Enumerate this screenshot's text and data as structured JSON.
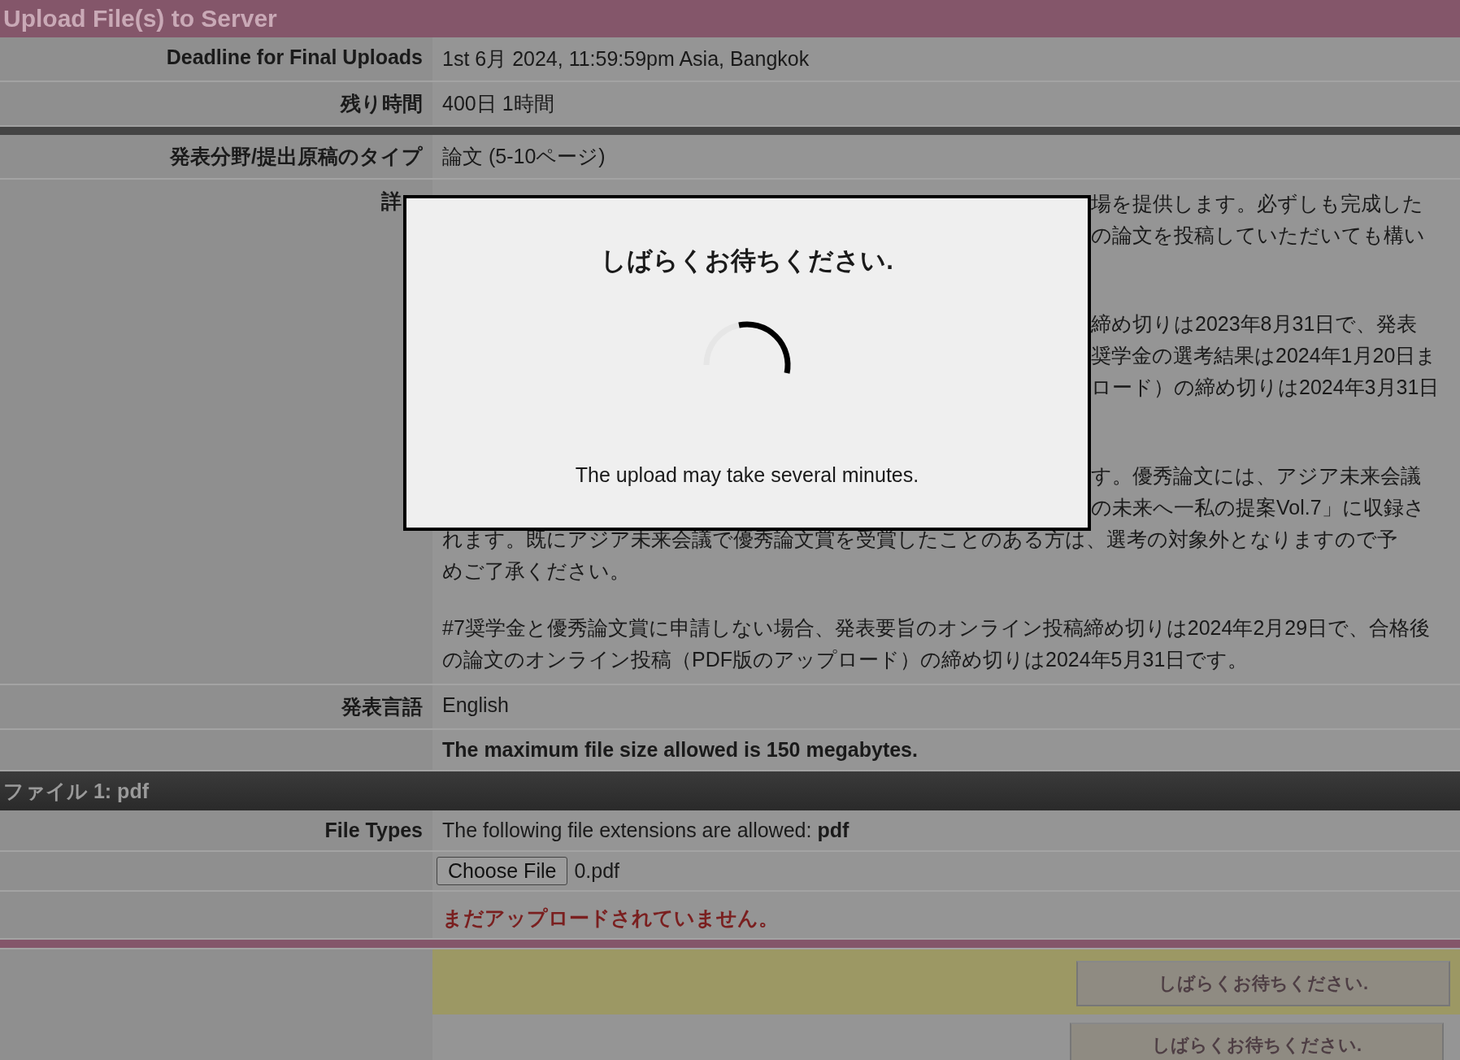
{
  "title": "Upload File(s) to Server",
  "rows": [
    {
      "kind": "text",
      "label": "Deadline for Final Uploads",
      "value": "1st 6月 2024, 11:59:59pm Asia, Bangkok"
    },
    {
      "kind": "text",
      "label": "残り時間",
      "value": "400日 1時間"
    },
    {
      "kind": "divider"
    },
    {
      "kind": "text",
      "label": "発表分野/提出原稿のタイプ",
      "value": "論文 (5-10ページ)"
    },
    {
      "kind": "details",
      "label": "詳",
      "label_covered": true,
      "paragraphs": [
        {
          "trailing_covered": true,
          "lines": [
            {
              "text": "場を提供します。必ずしも完成した",
              "covered": true
            },
            {
              "text": "の論文を投稿していただいても構い",
              "covered": true
            }
          ]
        },
        {
          "trailing_covered": true,
          "lines": [
            {
              "text": "締め切りは2023年8月31日で、発表",
              "covered": true
            },
            {
              "text": "奨学金の選考結果は2024年1月20日ま",
              "covered": true
            },
            {
              "text": "ロード）の締め切りは2024年3月31日",
              "covered": true
            }
          ]
        },
        {
          "trailing_covered": false,
          "lines": [
            {
              "text": "す。優秀論文には、アジア未来会議",
              "covered": true
            },
            {
              "text": "の未来へ一私の提案Vol.7」に収録さ",
              "covered": true
            },
            {
              "text": "れます。既にアジア未来会議で優秀論文賞を受賞したことのある方は、選考の対象外となりますので予",
              "covered": false
            },
            {
              "text": "めご了承ください。",
              "covered": false
            }
          ]
        },
        {
          "trailing_covered": false,
          "lines": [
            {
              "text": "#7奨学金と優秀論文賞に申請しない場合、発表要旨のオンライン投稿締め切りは2024年2月29日で、合格後の論文のオンライン投稿（PDF版のアップロード）の締め切りは2024年5月31日です。",
              "covered": false
            }
          ]
        }
      ]
    },
    {
      "kind": "text",
      "label": "発表言語",
      "value": "English"
    },
    {
      "kind": "note",
      "value": "The maximum file size allowed is 150 megabytes."
    },
    {
      "kind": "section",
      "value": "ファイル 1: pdf"
    },
    {
      "kind": "rich",
      "label": "File Types",
      "value": "The following file extensions are allowed: **pdf**"
    },
    {
      "kind": "file",
      "button": "Choose File",
      "file_name": "0.pdf"
    },
    {
      "kind": "status",
      "value": "まだアップロードされていません。"
    },
    {
      "kind": "accent"
    },
    {
      "kind": "submit",
      "highlight": true,
      "button": {
        "label": "しばらくお待ちください.",
        "disabled": true
      }
    },
    {
      "kind": "submit",
      "highlight": false,
      "button": {
        "label": "しばらくお待ちください.",
        "disabled": true
      }
    }
  ],
  "modal": {
    "title": "しばらくお待ちください.",
    "message": "The upload may take several minutes."
  }
}
